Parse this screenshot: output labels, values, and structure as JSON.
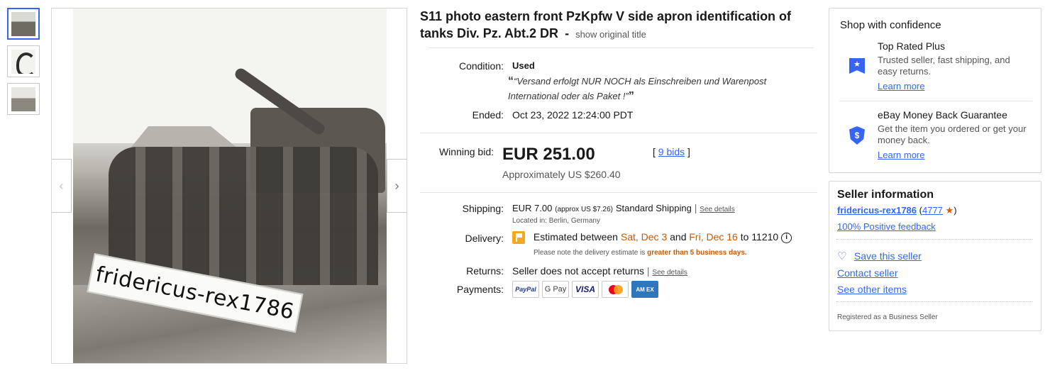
{
  "gallery": {
    "image_count": 3,
    "active_index": 0,
    "watermark_text": "fridericus-rex1786",
    "prev_arrow": "‹",
    "next_arrow": "›"
  },
  "listing": {
    "title": "S11 photo eastern front PzKpfw V side apron identification of tanks Div. Pz. Abt.2 DR",
    "title_separator": "-",
    "show_original_title": "show original title",
    "condition_label": "Condition:",
    "condition_value": "Used",
    "seller_note_open": "“",
    "seller_note": "“Versand erfolgt NUR NOCH als Einschreiben und Warenpost International oder als Paket !”",
    "seller_note_close": "”",
    "ended_label": "Ended:",
    "ended_value": "Oct 23, 2022 12:24:00 PDT",
    "winning_bid_label": "Winning bid:",
    "winning_bid_value": "EUR 251.00",
    "approx_value": "Approximately US $260.40",
    "bids_open": "[",
    "bids_link": "9 bids",
    "bids_close": "]",
    "shipping_label": "Shipping:",
    "shipping_price": "EUR 7.00",
    "shipping_approx": "(approx US $7.26)",
    "shipping_method": "Standard Shipping",
    "shipping_divider": "|",
    "shipping_see_details": "See details",
    "location": "Located in: Berlin, Germany",
    "delivery_label": "Delivery:",
    "delivery_prefix": "Estimated between",
    "delivery_start": "Sat, Dec 3",
    "delivery_and": "and",
    "delivery_end": "Fri, Dec 16",
    "delivery_to": "to 11210",
    "delivery_note_prefix": "Please note the delivery estimate is",
    "delivery_note_strong": "greater than 5 business days.",
    "returns_label": "Returns:",
    "returns_value": "Seller does not accept returns",
    "returns_divider": "|",
    "returns_see_details": "See details",
    "payments_label": "Payments:",
    "payment_methods": [
      "PayPal",
      "G Pay",
      "VISA",
      "",
      "AM EX"
    ]
  },
  "confidence": {
    "heading": "Shop with confidence",
    "items": [
      {
        "icon": "top-rated-badge-icon",
        "title": "Top Rated Plus",
        "desc": "Trusted seller, fast shipping, and easy returns.",
        "link": "Learn more"
      },
      {
        "icon": "money-back-shield-icon",
        "title": "eBay Money Back Guarantee",
        "desc": "Get the item you ordered or get your money back.",
        "link": "Learn more"
      }
    ]
  },
  "seller": {
    "heading": "Seller information",
    "name": "fridericus-rex1786",
    "feedback_open": "(",
    "feedback_count": "4777",
    "feedback_close": ")",
    "positive_feedback": "100% Positive feedback",
    "save_seller": "Save this seller",
    "contact": "Contact seller",
    "see_other": "See other items",
    "registered": "Registered as a Business Seller"
  },
  "colors": {
    "link": "#3665f3",
    "accent_orange": "#c35b07",
    "text": "#191919"
  }
}
